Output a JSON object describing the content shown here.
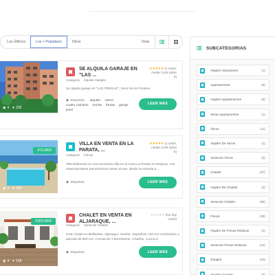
{
  "sort": {
    "options": [
      "Los Últimos",
      "Los + Populares",
      "Otros"
    ],
    "active_index": 1,
    "view_label": "Vista"
  },
  "listings": [
    {
      "title": "SE ALQUILA GARAJE EN \"LAS ...",
      "category_icon_color": "#e0585f",
      "rating_stars": 5,
      "rating_votes": "(1 votos,",
      "rating_avg": "media: 5,00 sobre",
      "rating_max": "5)",
      "category_label": "Categoría",
      "category": "Alquiler Garajes",
      "description": "Se alquila garaje en \"LAS FRESAS\", Jerez de la Frontera",
      "photo_views": "4",
      "photo_likes": "235",
      "price": "",
      "tags_label": "Etiquetas",
      "tags": [
        "alquiler",
        "cierzo",
        "cuatro caminos",
        "ermita",
        "fresas",
        "garaje",
        "jerez"
      ],
      "button": "LEER MÁS"
    },
    {
      "title": "VILLA EN VENTA EN LA PARATA, ...",
      "category_icon_color": "#18bccd",
      "rating_stars": 5,
      "rating_votes": "(1 votos,",
      "rating_avg": "media: 5,00 sobre",
      "rating_max": "5)",
      "category_label": "Categoría",
      "category": "Fincas",
      "description": "Villa Bellavista en una exclusiva villa en la zona La Parata en Mojacar, con espectaculares panorámicas vistas al mar, desde la entrada a ...",
      "photo_views": "4",
      "photo_likes": "185",
      "price": "470.000€",
      "tags_label": "Etiquetas",
      "tags": [],
      "button": "LEER MÁS"
    },
    {
      "title": "CHALET EN VENTA EN ALJARAQUE, ...",
      "category_icon_color": "#e0585f",
      "rating_stars": 0,
      "rating_votes": "(No hay",
      "rating_avg": "votos)",
      "rating_max": "",
      "category_label": "Categoría",
      "category": "Venta De Chalets",
      "description": "Gran chalet en Bellavista, Aljaraque, Huelva. Superficie 164 m2 construidos y parcela de 800 m2. Consta de 4 dormitorios, 3 baños, cocina d",
      "photo_views": "4",
      "photo_likes": "158",
      "price": "€300.000€",
      "tags_label": "Etiquetas",
      "tags": [],
      "button": "LEER MÁS"
    }
  ],
  "sidebar": {
    "title": "SUBCATEGORIAS",
    "items": [
      {
        "name": "Alquiler Vacaciones",
        "count": "(1)"
      },
      {
        "name": "Apartamentos",
        "count": "(5)"
      },
      {
        "name": "Alquiler Apartamentos",
        "count": "(8)"
      },
      {
        "name": "Venta Apartamentos",
        "count": "(1)"
      },
      {
        "name": "Áticos",
        "count": "(11)"
      },
      {
        "name": "Alquiler De Áticos",
        "count": "(1)"
      },
      {
        "name": "Venta De Áticos",
        "count": "(3)"
      },
      {
        "name": "Chalets",
        "count": "(97)"
      },
      {
        "name": "Alquiler De Chalets",
        "count": "(2)"
      },
      {
        "name": "Venta De Chalets",
        "count": "(86)"
      },
      {
        "name": "Fincas",
        "count": "(35)"
      },
      {
        "name": "Alquiler De Fincas Rústicas",
        "count": "(2)"
      },
      {
        "name": "Venta De Fincas Rústicas",
        "count": "(24)"
      },
      {
        "name": "Garajes",
        "count": "(19)"
      },
      {
        "name": "Alquiler Garajes",
        "count": "(6)"
      }
    ]
  },
  "colors": {
    "accent_green": "#2abd8e",
    "accent_teal": "#18bccd",
    "accent_red": "#e0585f",
    "star": "#f2b01e"
  }
}
